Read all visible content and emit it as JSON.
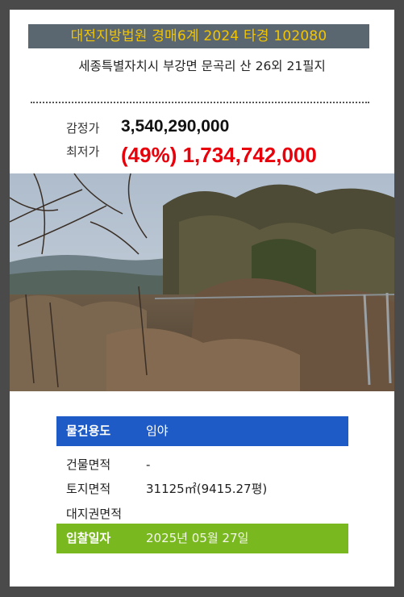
{
  "header": {
    "court_case": "대전지방법원 경매6계 2024 타경 102080",
    "address": "세종특별자치시 부강면 문곡리 산 26외 21필지"
  },
  "prices": {
    "appraisal_label": "감정가",
    "appraisal_value": "3,540,290,000",
    "min_label": "최저가",
    "min_value": "(49%) 1,734,742,000"
  },
  "info": {
    "usage_label": "물건용도",
    "usage_value": "임야",
    "building_area_label": "건물면적",
    "building_area_value": "-",
    "land_area_label": "토지면적",
    "land_area_value": "31125㎡(9415.27평)",
    "land_rights_label": "대지권면적",
    "land_rights_value": "",
    "bid_date_label": "입찰일자",
    "bid_date_value": "2025년 05월 27일"
  },
  "colors": {
    "banner_bg": "#5b6770",
    "banner_text": "#f2c500",
    "min_price": "#e8000b",
    "usage_row": "#1e5bc6",
    "date_row": "#7ab81f"
  }
}
